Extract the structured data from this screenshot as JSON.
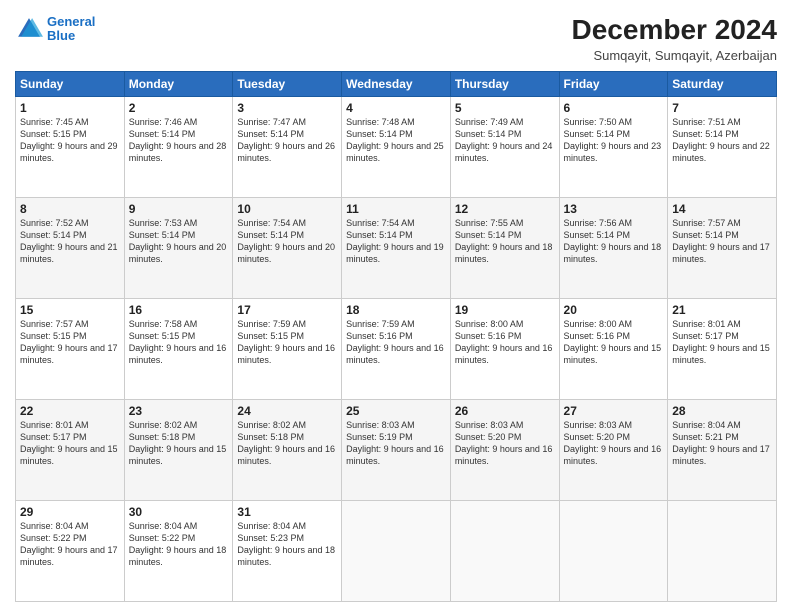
{
  "logo": {
    "line1": "General",
    "line2": "Blue"
  },
  "title": "December 2024",
  "subtitle": "Sumqayit, Sumqayit, Azerbaijan",
  "days_header": [
    "Sunday",
    "Monday",
    "Tuesday",
    "Wednesday",
    "Thursday",
    "Friday",
    "Saturday"
  ],
  "weeks": [
    [
      {
        "day": "1",
        "rise": "7:45 AM",
        "set": "5:15 PM",
        "daylight": "9 hours and 29 minutes."
      },
      {
        "day": "2",
        "rise": "7:46 AM",
        "set": "5:14 PM",
        "daylight": "9 hours and 28 minutes."
      },
      {
        "day": "3",
        "rise": "7:47 AM",
        "set": "5:14 PM",
        "daylight": "9 hours and 26 minutes."
      },
      {
        "day": "4",
        "rise": "7:48 AM",
        "set": "5:14 PM",
        "daylight": "9 hours and 25 minutes."
      },
      {
        "day": "5",
        "rise": "7:49 AM",
        "set": "5:14 PM",
        "daylight": "9 hours and 24 minutes."
      },
      {
        "day": "6",
        "rise": "7:50 AM",
        "set": "5:14 PM",
        "daylight": "9 hours and 23 minutes."
      },
      {
        "day": "7",
        "rise": "7:51 AM",
        "set": "5:14 PM",
        "daylight": "9 hours and 22 minutes."
      }
    ],
    [
      {
        "day": "8",
        "rise": "7:52 AM",
        "set": "5:14 PM",
        "daylight": "9 hours and 21 minutes."
      },
      {
        "day": "9",
        "rise": "7:53 AM",
        "set": "5:14 PM",
        "daylight": "9 hours and 20 minutes."
      },
      {
        "day": "10",
        "rise": "7:54 AM",
        "set": "5:14 PM",
        "daylight": "9 hours and 20 minutes."
      },
      {
        "day": "11",
        "rise": "7:54 AM",
        "set": "5:14 PM",
        "daylight": "9 hours and 19 minutes."
      },
      {
        "day": "12",
        "rise": "7:55 AM",
        "set": "5:14 PM",
        "daylight": "9 hours and 18 minutes."
      },
      {
        "day": "13",
        "rise": "7:56 AM",
        "set": "5:14 PM",
        "daylight": "9 hours and 18 minutes."
      },
      {
        "day": "14",
        "rise": "7:57 AM",
        "set": "5:14 PM",
        "daylight": "9 hours and 17 minutes."
      }
    ],
    [
      {
        "day": "15",
        "rise": "7:57 AM",
        "set": "5:15 PM",
        "daylight": "9 hours and 17 minutes."
      },
      {
        "day": "16",
        "rise": "7:58 AM",
        "set": "5:15 PM",
        "daylight": "9 hours and 16 minutes."
      },
      {
        "day": "17",
        "rise": "7:59 AM",
        "set": "5:15 PM",
        "daylight": "9 hours and 16 minutes."
      },
      {
        "day": "18",
        "rise": "7:59 AM",
        "set": "5:16 PM",
        "daylight": "9 hours and 16 minutes."
      },
      {
        "day": "19",
        "rise": "8:00 AM",
        "set": "5:16 PM",
        "daylight": "9 hours and 16 minutes."
      },
      {
        "day": "20",
        "rise": "8:00 AM",
        "set": "5:16 PM",
        "daylight": "9 hours and 15 minutes."
      },
      {
        "day": "21",
        "rise": "8:01 AM",
        "set": "5:17 PM",
        "daylight": "9 hours and 15 minutes."
      }
    ],
    [
      {
        "day": "22",
        "rise": "8:01 AM",
        "set": "5:17 PM",
        "daylight": "9 hours and 15 minutes."
      },
      {
        "day": "23",
        "rise": "8:02 AM",
        "set": "5:18 PM",
        "daylight": "9 hours and 15 minutes."
      },
      {
        "day": "24",
        "rise": "8:02 AM",
        "set": "5:18 PM",
        "daylight": "9 hours and 16 minutes."
      },
      {
        "day": "25",
        "rise": "8:03 AM",
        "set": "5:19 PM",
        "daylight": "9 hours and 16 minutes."
      },
      {
        "day": "26",
        "rise": "8:03 AM",
        "set": "5:20 PM",
        "daylight": "9 hours and 16 minutes."
      },
      {
        "day": "27",
        "rise": "8:03 AM",
        "set": "5:20 PM",
        "daylight": "9 hours and 16 minutes."
      },
      {
        "day": "28",
        "rise": "8:04 AM",
        "set": "5:21 PM",
        "daylight": "9 hours and 17 minutes."
      }
    ],
    [
      {
        "day": "29",
        "rise": "8:04 AM",
        "set": "5:22 PM",
        "daylight": "9 hours and 17 minutes."
      },
      {
        "day": "30",
        "rise": "8:04 AM",
        "set": "5:22 PM",
        "daylight": "9 hours and 18 minutes."
      },
      {
        "day": "31",
        "rise": "8:04 AM",
        "set": "5:23 PM",
        "daylight": "9 hours and 18 minutes."
      },
      null,
      null,
      null,
      null
    ]
  ]
}
